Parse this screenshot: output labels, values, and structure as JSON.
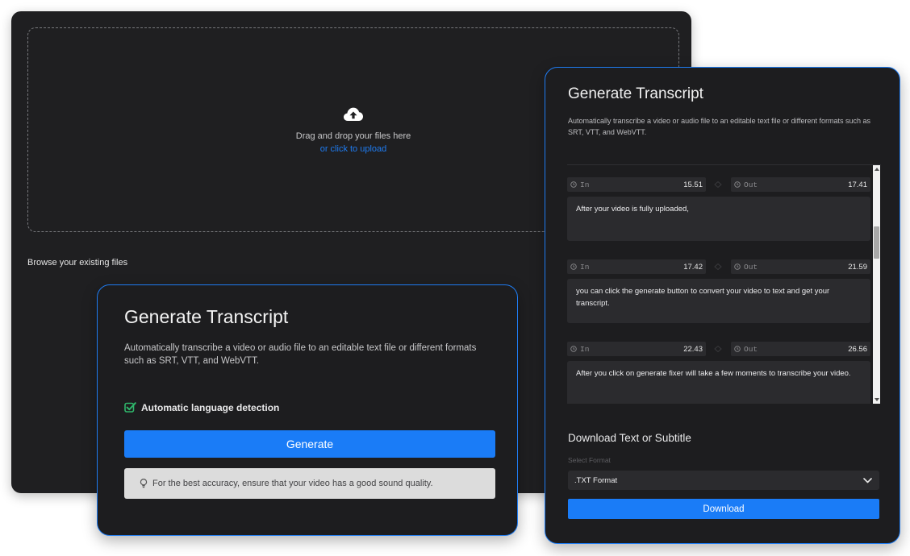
{
  "upload": {
    "drop_text": "Drag and drop your files here",
    "upload_link": "or click to upload",
    "icon": "cloud-upload-icon",
    "browse_label": "Browse your existing files"
  },
  "generate_card": {
    "title": "Generate Transcript",
    "description": "Automatically transcribe a video or audio file to an editable text file or different formats such as SRT, VTT, and WebVTT.",
    "language_detection": "Automatic language detection",
    "generate_button": "Generate",
    "tip": "For the best accuracy, ensure that your video has a good sound quality."
  },
  "transcript_card": {
    "title": "Generate Transcript",
    "description": "Automatically transcribe a video or audio file to an editable text file or different formats such as SRT, VTT, and WebVTT.",
    "in_label": "In",
    "out_label": "Out",
    "segments": [
      {
        "in": "15.51",
        "out": "17.41",
        "text": "After your video is fully uploaded,"
      },
      {
        "in": "17.42",
        "out": "21.59",
        "text": "you can click the generate button to convert your video to text and get your transcript."
      },
      {
        "in": "22.43",
        "out": "26.56",
        "text": "After you click on generate fixer will take a few moments to transcribe your video."
      }
    ],
    "download_title": "Download Text or Subtitle",
    "select_format_label": "Select Format",
    "selected_format": ".TXT Format",
    "download_button": "Download"
  },
  "colors": {
    "accent": "#1a7cf7",
    "panel_bg": "#1f1f21",
    "card_bg": "#1d1d1f",
    "field_bg": "#2b2b2e",
    "check_green": "#2fb56a"
  }
}
